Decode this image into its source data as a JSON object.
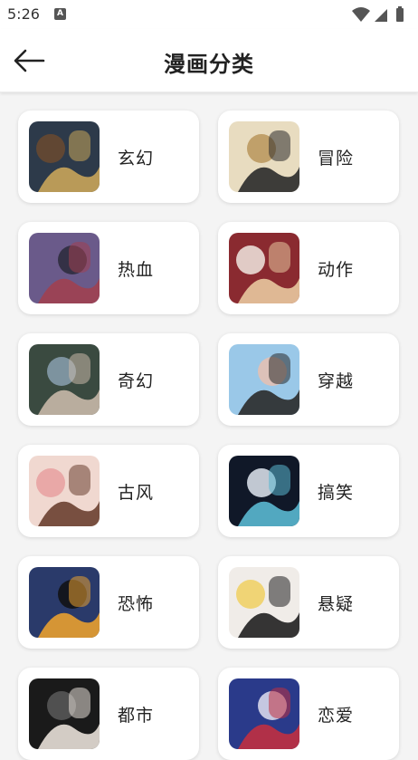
{
  "status_bar": {
    "time": "5:26",
    "notification_icon": "a-badge-icon",
    "icons": [
      "wifi-icon",
      "signal-icon",
      "battery-icon"
    ]
  },
  "header": {
    "back_icon": "arrow-left-icon",
    "title": "漫画分类"
  },
  "categories": [
    {
      "label": "玄幻",
      "thumb": "cover-xuanhuan",
      "colors": [
        "#2d3a4a",
        "#c9a55a",
        "#6b4a2f"
      ]
    },
    {
      "label": "冒险",
      "thumb": "cover-maoxian",
      "colors": [
        "#e8dcc0",
        "#2a2a2a",
        "#b8955a"
      ]
    },
    {
      "label": "热血",
      "thumb": "cover-rexue",
      "colors": [
        "#6a5a8a",
        "#a04050",
        "#2a2a3a"
      ]
    },
    {
      "label": "动作",
      "thumb": "cover-dongzuo",
      "colors": [
        "#8a2a30",
        "#e8c8a0",
        "#f0e8e0"
      ]
    },
    {
      "label": "奇幻",
      "thumb": "cover-qihuan",
      "colors": [
        "#3a4a40",
        "#c8b8a8",
        "#8aa0b0"
      ]
    },
    {
      "label": "穿越",
      "thumb": "cover-chuanyue",
      "colors": [
        "#9ac8e8",
        "#2a2a2a",
        "#e8c0b0"
      ]
    },
    {
      "label": "古风",
      "thumb": "cover-gufeng",
      "colors": [
        "#f0d8d0",
        "#6a4030",
        "#e8a0a0"
      ]
    },
    {
      "label": "搞笑",
      "thumb": "cover-gaoxiao",
      "colors": [
        "#101828",
        "#5ab8d0",
        "#e0e8f0"
      ]
    },
    {
      "label": "恐怖",
      "thumb": "cover-kongbu",
      "colors": [
        "#2a3a6a",
        "#e8a030",
        "#101010"
      ]
    },
    {
      "label": "悬疑",
      "thumb": "cover-xuanyi",
      "colors": [
        "#f0ece8",
        "#202020",
        "#f0d060"
      ]
    },
    {
      "label": "都市",
      "thumb": "cover-dushi",
      "colors": [
        "#1a1a1a",
        "#e8e0d8",
        "#5a5a5a"
      ]
    },
    {
      "label": "恋爱",
      "thumb": "cover-lianai",
      "colors": [
        "#2a3a8a",
        "#c03040",
        "#e0e0f0"
      ]
    }
  ]
}
